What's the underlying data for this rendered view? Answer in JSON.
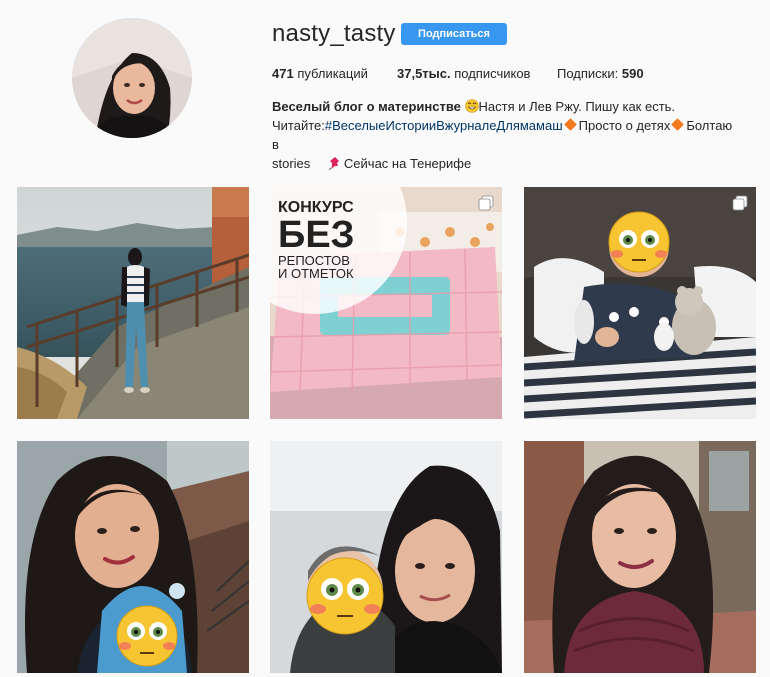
{
  "profile": {
    "username": "nasty_tasty",
    "follow_label": "Подписаться",
    "stats": {
      "posts_count": "471",
      "posts_label": " публикаций",
      "followers_count": "37,5тыс.",
      "followers_label": " подписчиков",
      "following_label": "Подписки: ",
      "following_count": "590"
    },
    "bio": {
      "name": "Веселый блог о материнстве",
      "line1_rest": "Настя и Лев Ржу. Пишу как есть.",
      "line2_prefix": "Читайте:",
      "hashtag": "#ВеселыеИсторииВжурналеДлямамаш",
      "line2_part2": "Просто о детях",
      "line2_part3": "Болтаю в",
      "line3_start": "stories",
      "line3_location": "Сейчас на Тенерифе"
    }
  },
  "posts": [
    {
      "id": "post-1",
      "description": "seaside-promenade-photo",
      "multi": false
    },
    {
      "id": "post-2",
      "description": "contest-quilt-photo",
      "multi": true,
      "overlay_text": [
        "КОНКУРС",
        "БЕЗ",
        "РЕПОСТОВ",
        "И ОТМЕТОК"
      ]
    },
    {
      "id": "post-3",
      "description": "child-with-toys-photo",
      "multi": true
    },
    {
      "id": "post-4",
      "description": "selfie-with-child-photo",
      "multi": false
    },
    {
      "id": "post-5",
      "description": "selfie-with-son-photo",
      "multi": false
    },
    {
      "id": "post-6",
      "description": "selfie-scarf-photo",
      "multi": false
    }
  ],
  "colors": {
    "follow_button": "#3897f0",
    "hashtag": "#003569",
    "diamond": "#f47a20",
    "background": "#fafafa"
  }
}
